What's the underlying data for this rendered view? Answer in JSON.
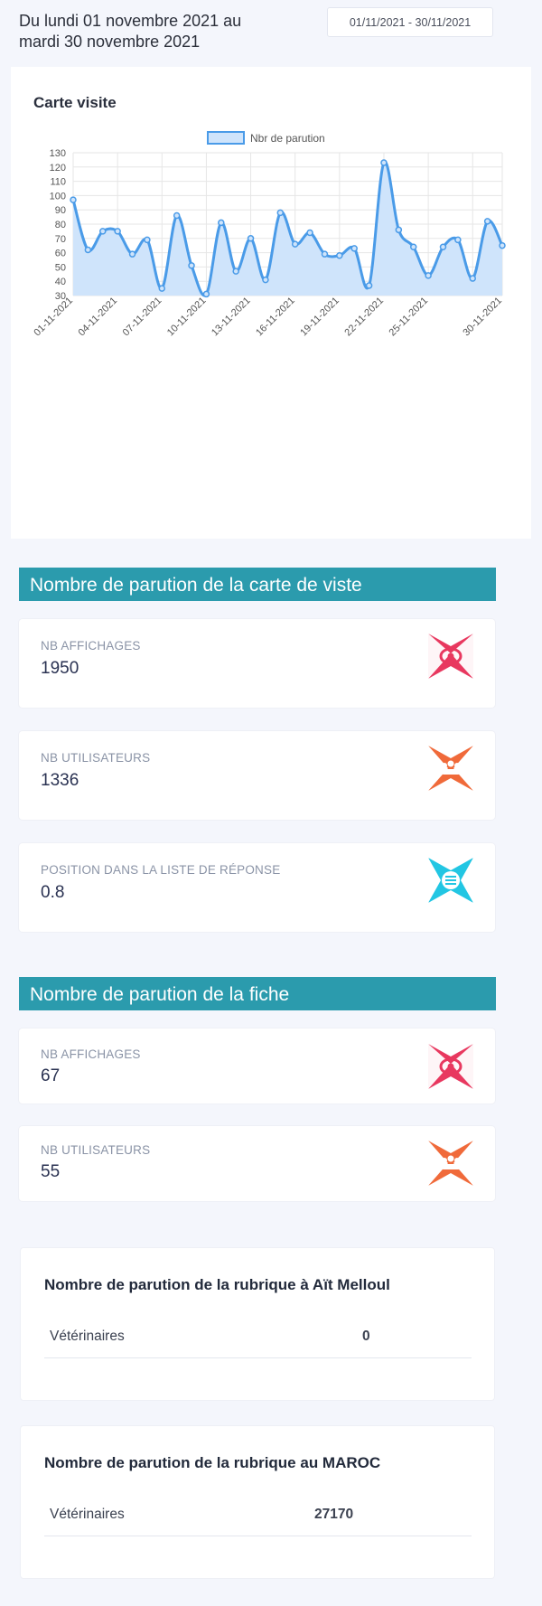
{
  "header": {
    "period_text": "Du lundi 01 novembre 2021 au mardi 30 novembre 2021",
    "date_range_value": "01/11/2021 - 30/11/2021"
  },
  "chart_card": {
    "title": "Carte visite"
  },
  "chart_data": {
    "type": "area",
    "legend": [
      "Nbr de parution"
    ],
    "legend_position": "top",
    "grid": true,
    "series": [
      {
        "name": "Nbr de parution",
        "values": [
          97,
          62,
          75,
          75,
          59,
          69,
          35,
          86,
          51,
          31,
          81,
          47,
          70,
          41,
          88,
          66,
          74,
          59,
          58,
          63,
          37,
          123,
          76,
          64,
          44,
          64,
          69,
          42,
          82,
          65
        ]
      }
    ],
    "x": [
      "01-11-2021",
      "02-11-2021",
      "03-11-2021",
      "04-11-2021",
      "05-11-2021",
      "06-11-2021",
      "07-11-2021",
      "08-11-2021",
      "09-11-2021",
      "10-11-2021",
      "11-11-2021",
      "12-11-2021",
      "13-11-2021",
      "14-11-2021",
      "15-11-2021",
      "16-11-2021",
      "17-11-2021",
      "18-11-2021",
      "19-11-2021",
      "20-11-2021",
      "21-11-2021",
      "22-11-2021",
      "23-11-2021",
      "24-11-2021",
      "25-11-2021",
      "26-11-2021",
      "27-11-2021",
      "28-11-2021",
      "29-11-2021",
      "30-11-2021"
    ],
    "x_tick_labels": [
      "01-11-2021",
      "04-11-2021",
      "07-11-2021",
      "10-11-2021",
      "13-11-2021",
      "16-11-2021",
      "19-11-2021",
      "22-11-2021",
      "25-11-2021",
      "30-11-2021"
    ],
    "y_ticks": [
      30,
      40,
      50,
      60,
      70,
      80,
      90,
      100,
      110,
      120,
      130
    ],
    "ylim": [
      30,
      130
    ],
    "line_color": "#4a9be8",
    "fill_color": "#cfe4fb"
  },
  "section1": {
    "title": "Nombre de parution de la carte de viste",
    "stats": [
      {
        "label": "NB AFFICHAGES",
        "value": "1950",
        "icon": "eye-icon",
        "color": "#e8385f"
      },
      {
        "label": "NB UTILISATEURS",
        "value": "1336",
        "icon": "users-icon",
        "color": "#f06a3a"
      },
      {
        "label": "POSITION DANS LA LISTE DE RÉPONSE",
        "value": "0.8",
        "icon": "list-icon",
        "color": "#22c6e3"
      }
    ]
  },
  "section2": {
    "title": "Nombre de parution de la fiche",
    "stats": [
      {
        "label": "NB AFFICHAGES",
        "value": "67",
        "icon": "eye-icon",
        "color": "#e8385f"
      },
      {
        "label": "NB UTILISATEURS",
        "value": "55",
        "icon": "users-icon",
        "color": "#f06a3a"
      }
    ]
  },
  "rubrique_local": {
    "title": "Nombre de parution de la rubrique à Aït Melloul",
    "rows": [
      {
        "name": "Vétérinaires",
        "count": "0"
      }
    ]
  },
  "rubrique_maroc": {
    "title": "Nombre de parution de la rubrique au MAROC",
    "rows": [
      {
        "name": "Vétérinaires",
        "count": "27170"
      }
    ]
  }
}
